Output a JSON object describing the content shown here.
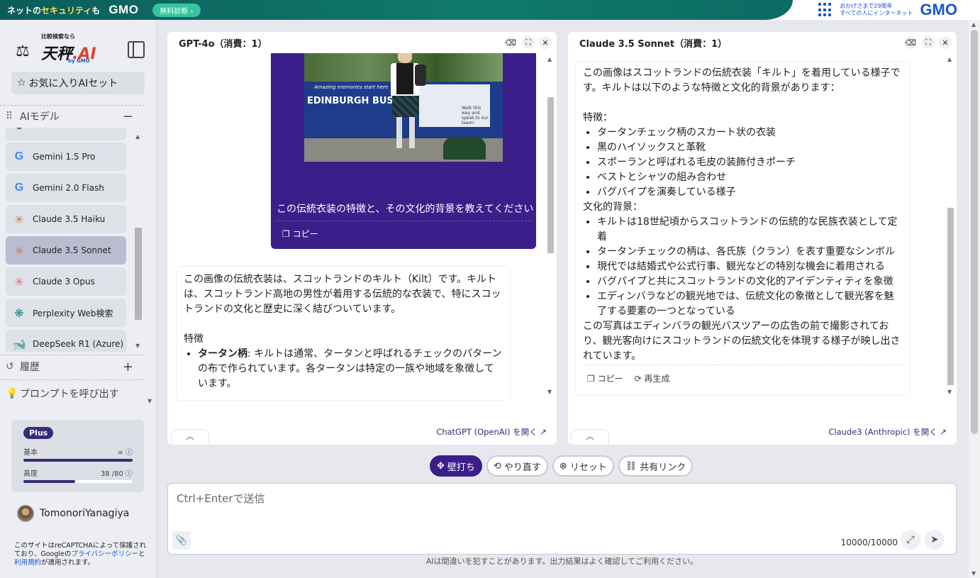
{
  "banner": {
    "text_pre": "ネットの",
    "text_highlight": "セキュリティ",
    "text_post": "も",
    "brand": "GMO",
    "diagnose_button": "無料診断 ›",
    "anniversary_line1": "おかげさまで29周年",
    "anniversary_line2": "すべての人にインターネット",
    "brand_right": "GMO"
  },
  "sidebar": {
    "logo_small": "比較検索なら",
    "logo_name_1": "天秤",
    "logo_name_2": ".AI",
    "logo_by": "by GMO",
    "favorites_label": "お気に入りAIセット",
    "models_heading": "AIモデル",
    "models": [
      {
        "label": "Gemini 1.5 Pro",
        "icon": "google-icon"
      },
      {
        "label": "Gemini 2.0 Flash",
        "icon": "google-icon"
      },
      {
        "label": "Claude 3.5 Haiku",
        "icon": "claude-icon"
      },
      {
        "label": "Claude 3.5 Sonnet",
        "icon": "claude-icon",
        "active": true
      },
      {
        "label": "Claude 3 Opus",
        "icon": "claude-icon"
      },
      {
        "label": "Perplexity Web検索",
        "icon": "perplexity-icon"
      },
      {
        "label": "DeepSeek R1 (Azure)",
        "icon": "deepseek-icon"
      }
    ],
    "history_heading": "履歴",
    "prompt_heading": "プロンプトを呼び出す",
    "plan": {
      "badge": "Plus",
      "basic_label": "基本",
      "basic_value": "∞",
      "advanced_label": "高度",
      "advanced_value": "38 /80",
      "advanced_fraction": 0.475
    },
    "username": "TomonoriYanagiya",
    "recaptcha_pre": "このサイトはreCAPTCHAによって保護されており、Googleの",
    "recaptcha_privacy": "プライバシーポリシー",
    "recaptcha_mid": "と",
    "recaptcha_terms": "利用規約",
    "recaptcha_post": "が適用されます。"
  },
  "panel_left": {
    "title": "GPT-4o（消費：1）",
    "photo_tagline": "Amazing memories start here",
    "photo_sign": "EDINBURGH BUS TO",
    "photo_side": "Walk this way and speak to our team!",
    "user_prompt": "この伝統衣装の特徴と、その文化的背景を教えてください",
    "copy_label": "コピー",
    "answer_intro": "この画像の伝統衣装は、スコットランドのキルト（Kilt）です。キルトは、スコットランド高地の男性が着用する伝統的な衣装で、特にスコットランドの文化と歴史に深く結びついています。",
    "answer_heading": "特徴",
    "answer_item_bold": "タータン柄",
    "answer_item_text": ": キルトは通常、タータンと呼ばれるチェックのパターンの布で作られています。各タータンは特定の一族や地域を象徴しています。",
    "open_link": "ChatGPT (OpenAI) を開く"
  },
  "panel_right": {
    "title": "Claude 3.5 Sonnet（消費：1）",
    "intro": "この画像はスコットランドの伝統衣装「キルト」を着用している様子です。キルトは以下のような特徴と文化的背景があります：",
    "features_heading": "特徴：",
    "features": [
      "タータンチェック柄のスカート状の衣装",
      "黒のハイソックスと革靴",
      "スポーランと呼ばれる毛皮の装飾付きポーチ",
      "ベストとシャツの組み合わせ",
      "バグパイプを演奏している様子"
    ],
    "culture_heading": "文化的背景：",
    "culture": [
      "キルトは18世紀頃からスコットランドの伝統的な民族衣装として定着",
      "タータンチェックの柄は、各氏族（クラン）を表す重要なシンボル",
      "現代では結婚式や公式行事、観光などの特別な機会に着用される",
      "バグパイプと共にスコットランドの文化的アイデンティティを象徴",
      "エディンバラなどの観光地では、伝統文化の象徴として観光客を魅了する要素の一つとなっている"
    ],
    "closing": "この写真はエディンバラの観光バスツアーの広告の前で撮影されており、観光客向けにスコットランドの伝統文化を体現する様子が映し出されています。",
    "copy_label": "コピー",
    "regenerate_label": "再生成",
    "open_link": "Claude3 (Anthropic) を開く"
  },
  "actions": {
    "kabeuchi": "壁打ち",
    "redo": "やり直す",
    "reset": "リセット",
    "share": "共有リンク"
  },
  "input": {
    "placeholder": "Ctrl+Enterで送信",
    "counter": "10000/10000"
  },
  "disclaimer": "AIは間違いを犯すことがあります。出力結果はよく確認してご利用ください。"
}
